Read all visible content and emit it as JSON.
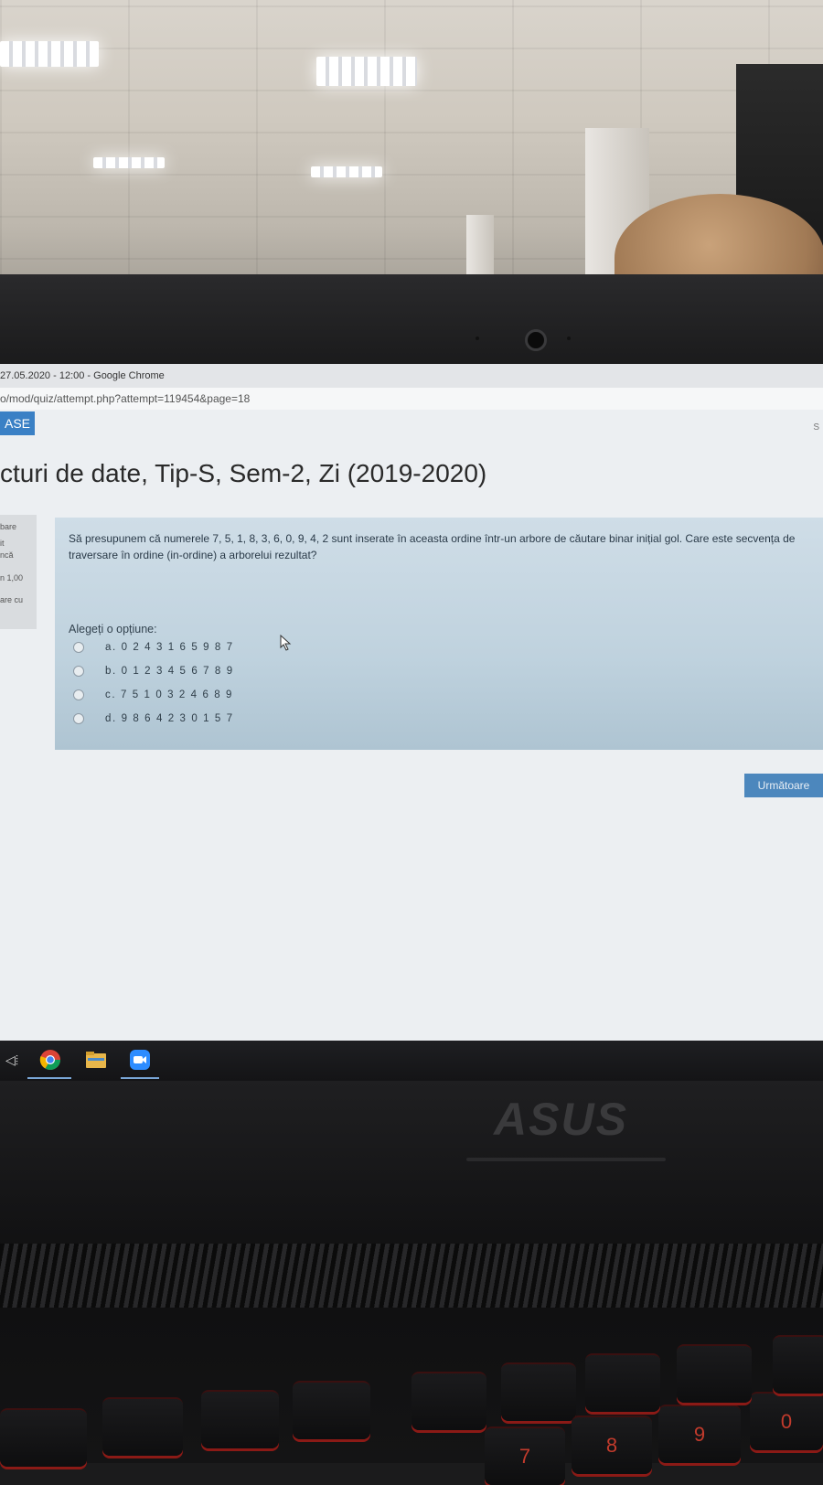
{
  "browser": {
    "title": "27.05.2020 - 12:00 - Google Chrome",
    "url": "o/mod/quiz/attempt.php?attempt=119454&page=18"
  },
  "header": {
    "case_button": "ASE",
    "course_title": "cturi de date, Tip-S, Sem-2, Zi (2019-2020)"
  },
  "sidebar": {
    "lines": [
      "bare",
      "it",
      "ncă",
      "n 1,00",
      "are cu"
    ]
  },
  "question": {
    "text": "Să presupunem că numerele 7, 5, 1, 8, 3, 6, 0, 9, 4, 2 sunt inserate în aceasta ordine într-un arbore de căutare binar inițial gol. Care este secvența de traversare în ordine (in-ordine) a arborelui rezultat?",
    "prompt": "Alegeți o opțiune:",
    "options": [
      {
        "label": "a. 0 2 4 3 1 6 5 9 8 7"
      },
      {
        "label": "b. 0 1 2 3 4 5 6 7 8 9"
      },
      {
        "label": "c. 7 5 1 0 3 2 4 6 8 9"
      },
      {
        "label": "d. 9 8 6 4 2 3 0 1 5 7"
      }
    ]
  },
  "navigation": {
    "next_label": "Următoare"
  },
  "laptop": {
    "brand": "ASUS",
    "keys": [
      "",
      "",
      "",
      "",
      "",
      "",
      "7",
      "8",
      "9",
      "0"
    ]
  },
  "taskbar": {
    "icons": [
      "speaker-icon",
      "chrome-icon",
      "file-explorer-icon",
      "zoom-icon"
    ]
  }
}
